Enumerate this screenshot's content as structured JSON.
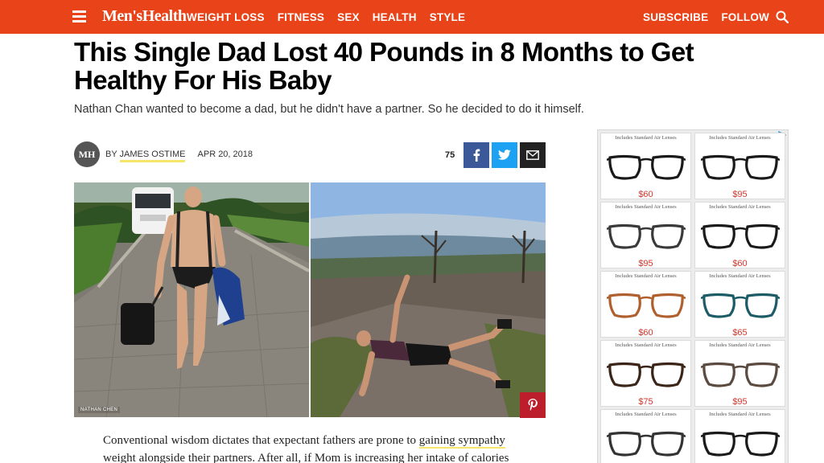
{
  "nav": {
    "logo": "Men'sHealth",
    "links": [
      "WEIGHT LOSS",
      "FITNESS",
      "SEX",
      "HEALTH",
      "STYLE"
    ],
    "right": [
      "SUBSCRIBE",
      "FOLLOW"
    ],
    "brand_color": "#e94419"
  },
  "article": {
    "headline": "This Single Dad Lost 40 Pounds in 8 Months to Get Healthy For His Baby",
    "dek": "Nathan Chan wanted to become a dad, but he didn't have a partner. So he decided to do it himself.",
    "avatar": "MH",
    "by": "BY",
    "author": "JAMES OSTIME",
    "date": "APR 20, 2018",
    "share_count": "75",
    "photo_credit": "NATHAN CHEN",
    "body_before": "Conventional wisdom dictates that expectant fathers are prone to ",
    "body_link": "gaining sympathy",
    "body_after": " weight alongside their partners. After all, if Mom is increasing her intake of calories"
  },
  "ad": {
    "caption": "Includes Standard Air Lenses",
    "prices": [
      "$60",
      "$95",
      "$95",
      "$60",
      "$60",
      "$65",
      "$75",
      "$95",
      "",
      ""
    ],
    "frame_colors": [
      "#1a1a1a",
      "#1a1a1a",
      "#3a3a3a",
      "#1a1a1a",
      "#b0602e",
      "#1c5c66",
      "#3b2418",
      "#5a4a40",
      "#333333",
      "#1a1a1a"
    ]
  }
}
